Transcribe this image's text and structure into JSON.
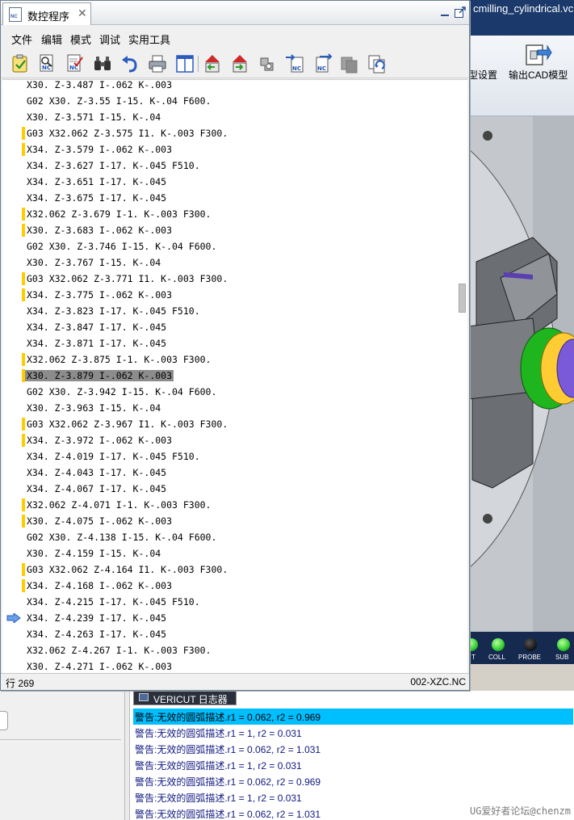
{
  "background_app": {
    "title": "cmilling_cylindrical.vcp",
    "ribbon": {
      "items": [
        {
          "label": "型设置"
        },
        {
          "label": "输出CAD模型"
        }
      ]
    },
    "status_lamps": [
      {
        "label": "T",
        "color": "#32cd32"
      },
      {
        "label": "COLL",
        "color": "#32cd32"
      },
      {
        "label": "PROBE",
        "color": "#1a1a1a"
      },
      {
        "label": "SUB",
        "color": "#32cd32"
      }
    ]
  },
  "nc_window": {
    "tab_title": "数控程序",
    "menu": [
      "文件",
      "编辑",
      "模式",
      "调试",
      "实用工具"
    ],
    "toolbar_icons": [
      "check-syntax-icon",
      "nc-search-icon",
      "nc-verify-icon",
      "binoculars-icon",
      "undo-icon",
      "print-icon",
      "split-view-icon",
      "step-back-icon",
      "step-forward-icon",
      "settings-icon",
      "nc-import-icon",
      "nc-export-icon",
      "copy-disabled-icon",
      "nc-refresh-icon"
    ],
    "code_lines": [
      {
        "text": "X30. Z-3.487 I-.062 K-.003",
        "mark": false
      },
      {
        "text": "G02 X30. Z-3.55 I-15. K-.04 F600.",
        "mark": false
      },
      {
        "text": "X30. Z-3.571 I-15. K-.04",
        "mark": false
      },
      {
        "text": "G03 X32.062 Z-3.575 I1. K-.003 F300.",
        "mark": true
      },
      {
        "text": "X34. Z-3.579 I-.062 K-.003",
        "mark": true
      },
      {
        "text": "X34. Z-3.627 I-17. K-.045 F510.",
        "mark": false
      },
      {
        "text": "X34. Z-3.651 I-17. K-.045",
        "mark": false
      },
      {
        "text": "X34. Z-3.675 I-17. K-.045",
        "mark": false
      },
      {
        "text": "X32.062 Z-3.679 I-1. K-.003 F300.",
        "mark": true
      },
      {
        "text": "X30. Z-3.683 I-.062 K-.003",
        "mark": true
      },
      {
        "text": "G02 X30. Z-3.746 I-15. K-.04 F600.",
        "mark": false
      },
      {
        "text": "X30. Z-3.767 I-15. K-.04",
        "mark": false
      },
      {
        "text": "G03 X32.062 Z-3.771 I1. K-.003 F300.",
        "mark": true
      },
      {
        "text": "X34. Z-3.775 I-.062 K-.003",
        "mark": true
      },
      {
        "text": "X34. Z-3.823 I-17. K-.045 F510.",
        "mark": false
      },
      {
        "text": "X34. Z-3.847 I-17. K-.045",
        "mark": false
      },
      {
        "text": "X34. Z-3.871 I-17. K-.045",
        "mark": false
      },
      {
        "text": "X32.062 Z-3.875 I-1. K-.003 F300.",
        "mark": true
      },
      {
        "text": "X30. Z-3.879 I-.062 K-.003",
        "mark": true,
        "highlight": true
      },
      {
        "text": "G02 X30. Z-3.942 I-15. K-.04 F600.",
        "mark": false
      },
      {
        "text": "X30. Z-3.963 I-15. K-.04",
        "mark": false
      },
      {
        "text": "G03 X32.062 Z-3.967 I1. K-.003 F300.",
        "mark": true
      },
      {
        "text": "X34. Z-3.972 I-.062 K-.003",
        "mark": true
      },
      {
        "text": "X34. Z-4.019 I-17. K-.045 F510.",
        "mark": false
      },
      {
        "text": "X34. Z-4.043 I-17. K-.045",
        "mark": false
      },
      {
        "text": "X34. Z-4.067 I-17. K-.045",
        "mark": false
      },
      {
        "text": "X32.062 Z-4.071 I-1. K-.003 F300.",
        "mark": true
      },
      {
        "text": "X30. Z-4.075 I-.062 K-.003",
        "mark": true
      },
      {
        "text": "G02 X30. Z-4.138 I-15. K-.04 F600.",
        "mark": false
      },
      {
        "text": "X30. Z-4.159 I-15. K-.04",
        "mark": false
      },
      {
        "text": "G03 X32.062 Z-4.164 I1. K-.003 F300.",
        "mark": true
      },
      {
        "text": "X34. Z-4.168 I-.062 K-.003",
        "mark": true
      },
      {
        "text": "X34. Z-4.215 I-17. K-.045 F510.",
        "mark": false
      },
      {
        "text": "X34. Z-4.239 I-17. K-.045",
        "mark": false,
        "current": true
      },
      {
        "text": "X34. Z-4.263 I-17. K-.045",
        "mark": false
      },
      {
        "text": "X32.062 Z-4.267 I-1. K-.003 F300.",
        "mark": false
      },
      {
        "text": "X30. Z-4.271 I-.062 K-.003",
        "mark": false
      }
    ],
    "status_left": "行 269",
    "status_right": "002-XZC.NC"
  },
  "log_panel": {
    "tab_label": "VERICUT 日志器",
    "lines": [
      {
        "text": "警告:无效的圆弧描述.r1 = 0.062, r2 = 0.969",
        "selected": true
      },
      {
        "text": "警告:无效的圆弧描述.r1 = 1, r2 = 0.031"
      },
      {
        "text": "警告:无效的圆弧描述.r1 = 0.062, r2 = 1.031"
      },
      {
        "text": "警告:无效的圆弧描述.r1 = 1, r2 = 0.031"
      },
      {
        "text": "警告:无效的圆弧描述.r1 = 0.062, r2 = 0.969"
      },
      {
        "text": "警告:无效的圆弧描述.r1 = 1, r2 = 0.031"
      },
      {
        "text": "警告:无效的圆弧描述.r1 = 0.062, r2 = 1.031"
      }
    ]
  },
  "watermark": "UG爱好者论坛@chenzm",
  "colors": {
    "marker": "#ffcc00",
    "highlight": "#8c8c8c",
    "log_selected": "#00bfff",
    "log_text": "#101880",
    "title_bar": "#1b3a6b"
  }
}
